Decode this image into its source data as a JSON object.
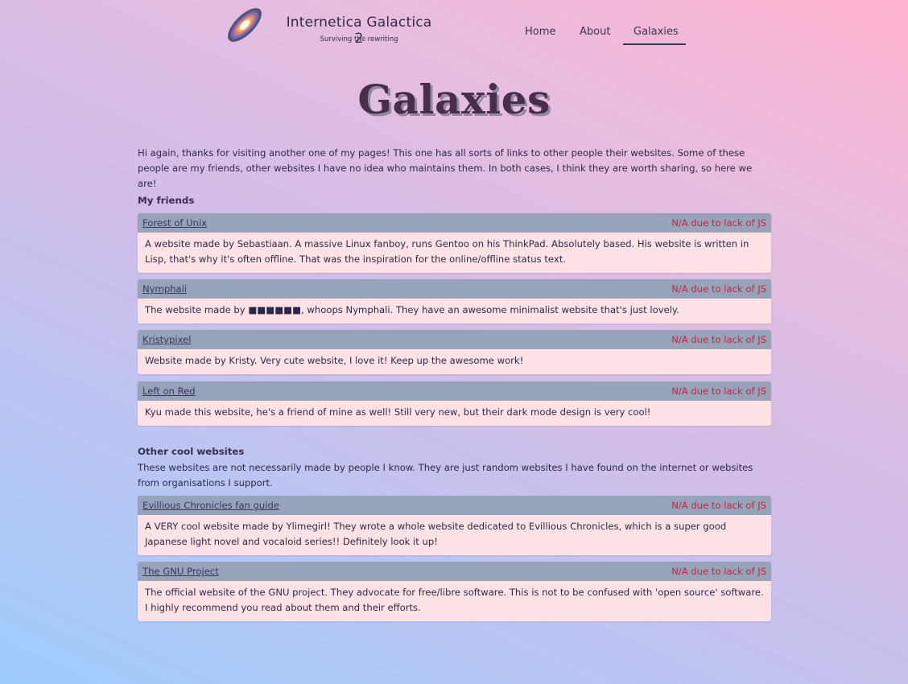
{
  "site": {
    "title": "Internetica Galactica 2",
    "subtitle": "Surviving the rewriting",
    "logo_icon": "galaxy-icon"
  },
  "nav": [
    {
      "label": "Home"
    },
    {
      "label": "About"
    },
    {
      "label": "Galaxies",
      "active": true
    }
  ],
  "page": {
    "title": "Galaxies",
    "intro": "Hi again, thanks for visiting another one of my pages! This one has all sorts of links to other people their websites. Some of these people are my friends, other websites I have no idea who maintains them. In both cases, I think they are worth sharing, so here we are!"
  },
  "friends": {
    "heading": "My friends",
    "items": [
      {
        "name": "Forest of Unix",
        "status": "N/A due to lack of JS",
        "description": "A website made by Sebastiaan. A massive Linux fanboy, runs Gentoo on his ThinkPad. Absolutely based. His website is written in Lisp, that's why it's often offline. That was the inspiration for the online/offline status text."
      },
      {
        "name": "Nymphali",
        "status": "N/A due to lack of JS",
        "description": "The website made by ■■■■■■, whoops Nymphali. They have an awesome minimalist website that's just lovely."
      },
      {
        "name": "Kristypixel",
        "status": "N/A due to lack of JS",
        "description": "Website made by Kristy. Very cute website, I love it! Keep up the awesome work!"
      },
      {
        "name": "Left on Red",
        "status": "N/A due to lack of JS",
        "description": "Kyu made this website, he's a friend of mine as well! Still very new, but their dark mode design is very cool!"
      }
    ]
  },
  "others": {
    "heading": "Other cool websites",
    "description": "These websites are not necessarily made by people I know. They are just random websites I have found on the internet or websites from organisations I support.",
    "items": [
      {
        "name": "Evillious Chronicles fan guide",
        "status": "N/A due to lack of JS",
        "description": "A VERY cool website made by Ylimegirl! They wrote a whole website dedicated to Evillious Chronicles, which is a super good Japanese light novel and vocaloid series!! Definitely look it up!"
      },
      {
        "name": "The GNU Project",
        "status": "N/A due to lack of JS",
        "description": "The official website of the GNU project. They advocate for free/libre software. This is not to be confused with 'open source' software. I highly recommend you read about them and their efforts."
      }
    ]
  },
  "colors": {
    "status_text": "#d0213e",
    "card_header": "#96a3b8",
    "card_body": "#ffe2e6",
    "title": "#4a2d4e"
  }
}
